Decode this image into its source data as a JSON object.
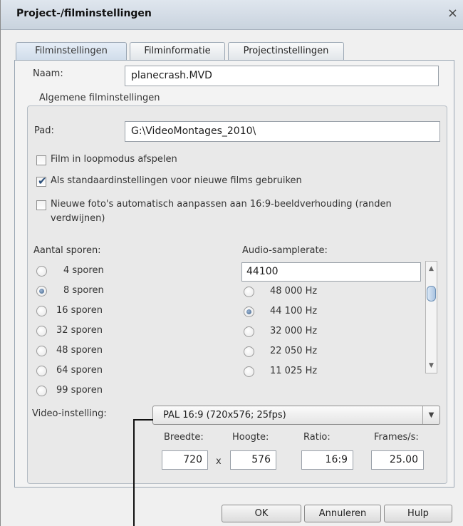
{
  "window": {
    "title": "Project-/filminstellingen",
    "close_glyph": "×"
  },
  "tabs": [
    {
      "label": "Filminstellingen",
      "active": true
    },
    {
      "label": "Filminformatie",
      "active": false
    },
    {
      "label": "Projectinstellingen",
      "active": false
    }
  ],
  "name_field": {
    "label": "Naam:",
    "value": "planecrash.MVD"
  },
  "general": {
    "title": "Algemene filminstellingen",
    "path_label": "Pad:",
    "path_value": "G:\\VideoMontages_2010\\",
    "checkboxes": [
      {
        "label": "Film in loopmodus afspelen",
        "checked": false
      },
      {
        "label": "Als standaardinstellingen voor nieuwe films gebruiken",
        "checked": true
      },
      {
        "label_line1": "Nieuwe foto's automatisch aanpassen aan 16:9-beeldverhouding (randen",
        "label_line2": "verdwijnen)",
        "checked": false
      }
    ]
  },
  "tracks": {
    "label": "Aantal sporen:",
    "options": [
      {
        "label": "4 sporen",
        "selected": false
      },
      {
        "label": "8 sporen",
        "selected": true
      },
      {
        "label": "16 sporen",
        "selected": false
      },
      {
        "label": "32 sporen",
        "selected": false
      },
      {
        "label": "48 sporen",
        "selected": false
      },
      {
        "label": "64 sporen",
        "selected": false
      },
      {
        "label": "99 sporen",
        "selected": false
      }
    ]
  },
  "samplerate": {
    "label": "Audio-samplerate:",
    "value": "44100",
    "options": [
      {
        "label": "48 000 Hz",
        "selected": false
      },
      {
        "label": "44 100 Hz",
        "selected": true
      },
      {
        "label": "32 000 Hz",
        "selected": false
      },
      {
        "label": "22 050 Hz",
        "selected": false
      },
      {
        "label": "11 025 Hz",
        "selected": false
      }
    ]
  },
  "video": {
    "label": "Video-instelling:",
    "selected": "PAL 16:9 (720x576; 25fps)",
    "width_label": "Breedte:",
    "width": "720",
    "times": "x",
    "height_label": "Hoogte:",
    "height": "576",
    "ratio_label": "Ratio:",
    "ratio": "16:9",
    "fps_label": "Frames/s:",
    "fps": "25.00"
  },
  "buttons": {
    "ok": "OK",
    "cancel": "Annuleren",
    "help": "Hulp"
  }
}
